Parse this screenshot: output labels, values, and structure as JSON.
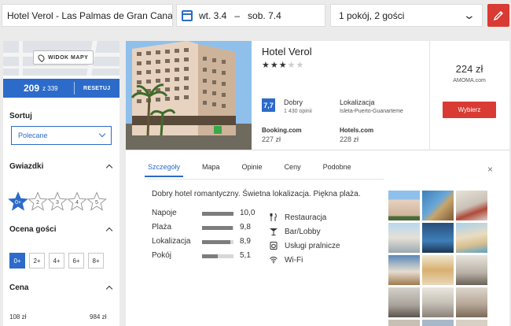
{
  "search": {
    "destination": "Hotel Verol - Las Palmas de Gran Canar",
    "date_from": "wt. 3.4",
    "date_sep": "–",
    "date_to": "sob. 7.4",
    "rooms_guests": "1 pokój, 2 gości",
    "edit_color": "#d93a33"
  },
  "sidebar": {
    "map_button": "WIDOK MAPY",
    "price_filter": {
      "from": "209",
      "to_label": "z 339",
      "reset": "RESETUJ"
    },
    "sort": {
      "label": "Sortuj",
      "selected": "Polecane"
    },
    "stars": {
      "label": "Gwiazdki",
      "options": [
        "0+",
        "2",
        "3",
        "4",
        "5"
      ],
      "selected_index": 0
    },
    "guest_rating": {
      "label": "Ocena gości",
      "options": [
        "0+",
        "2+",
        "4+",
        "6+",
        "8+"
      ],
      "selected_index": 0
    },
    "price": {
      "label": "Cena",
      "min": "108 zł",
      "max": "984 zł"
    }
  },
  "hotel": {
    "name": "Hotel Verol",
    "stars": 3,
    "stars_max": 5,
    "score": "7,7",
    "score_word": "Dobry",
    "reviews": "1 430 opinii",
    "location_title": "Lokalizacja",
    "location_value": "Isleta-Puerto-Guanarteme",
    "offers": [
      {
        "site": "Booking.com",
        "price": "227 zł"
      },
      {
        "site": "Hotels.com",
        "price": "228 zł"
      }
    ],
    "best_price": "224 zł",
    "best_site": "AMOMA.com",
    "book_button": "Wybierz"
  },
  "details": {
    "tabs": [
      "Szczegóły",
      "Mapa",
      "Opinie",
      "Ceny",
      "Podobne"
    ],
    "active_tab": 0,
    "summary": "Dobry hotel romantyczny. Świetna lokalizacja. Piękna plaża.",
    "metrics": [
      {
        "label": "Napoje",
        "value": "10,0",
        "score": 10.0
      },
      {
        "label": "Plaża",
        "value": "9,8",
        "score": 9.8
      },
      {
        "label": "Lokalizacja",
        "value": "8,9",
        "score": 8.9
      },
      {
        "label": "Pokój",
        "value": "5,1",
        "score": 5.1
      }
    ],
    "amenities": [
      {
        "label": "Restauracja",
        "icon": "restaurant-icon"
      },
      {
        "label": "Bar/Lobby",
        "icon": "cocktail-icon"
      },
      {
        "label": "Usługi pralnicze",
        "icon": "laundry-icon"
      },
      {
        "label": "Wi-Fi",
        "icon": "wifi-icon"
      }
    ],
    "close": "×"
  },
  "colors": {
    "accent": "#2c6bc9",
    "cta": "#d93a33"
  }
}
